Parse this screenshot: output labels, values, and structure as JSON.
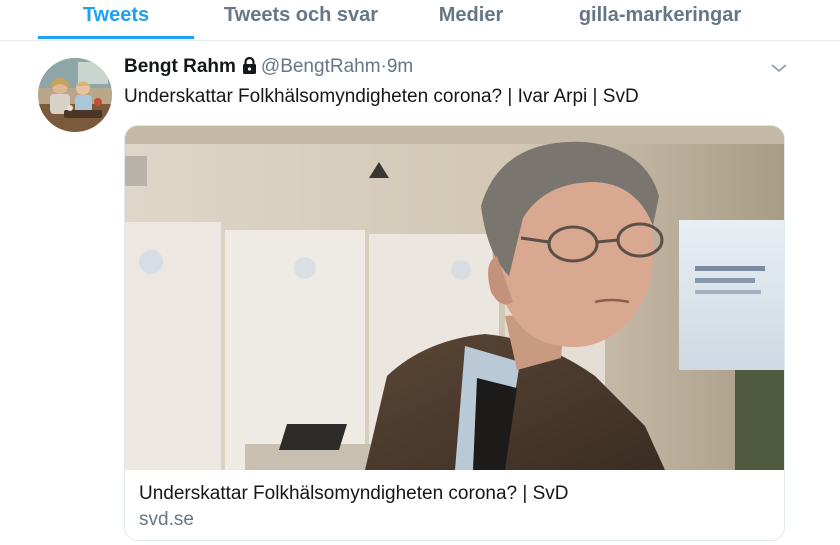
{
  "tabs": [
    {
      "label": "Tweets",
      "active": true
    },
    {
      "label": "Tweets och svar",
      "active": false
    },
    {
      "label": "Medier",
      "active": false
    },
    {
      "label": "gilla-markeringar",
      "active": false
    }
  ],
  "tweet": {
    "author_name": "Bengt Rahm",
    "locked_icon": "lock-icon",
    "handle": "@BengtRahm",
    "separator": "·",
    "time": "9m",
    "text": "Underskattar Folkhälsomyndigheten corona? | Ivar Arpi | SvD",
    "menu_icon": "chevron-down-icon"
  },
  "card": {
    "title": "Underskattar Folkhälsomyndigheten corona? | SvD",
    "domain": "svd.se"
  },
  "colors": {
    "accent": "#1da1f2",
    "secondary_text": "#657786",
    "primary_text": "#14171a",
    "border": "#e6ecf0"
  }
}
